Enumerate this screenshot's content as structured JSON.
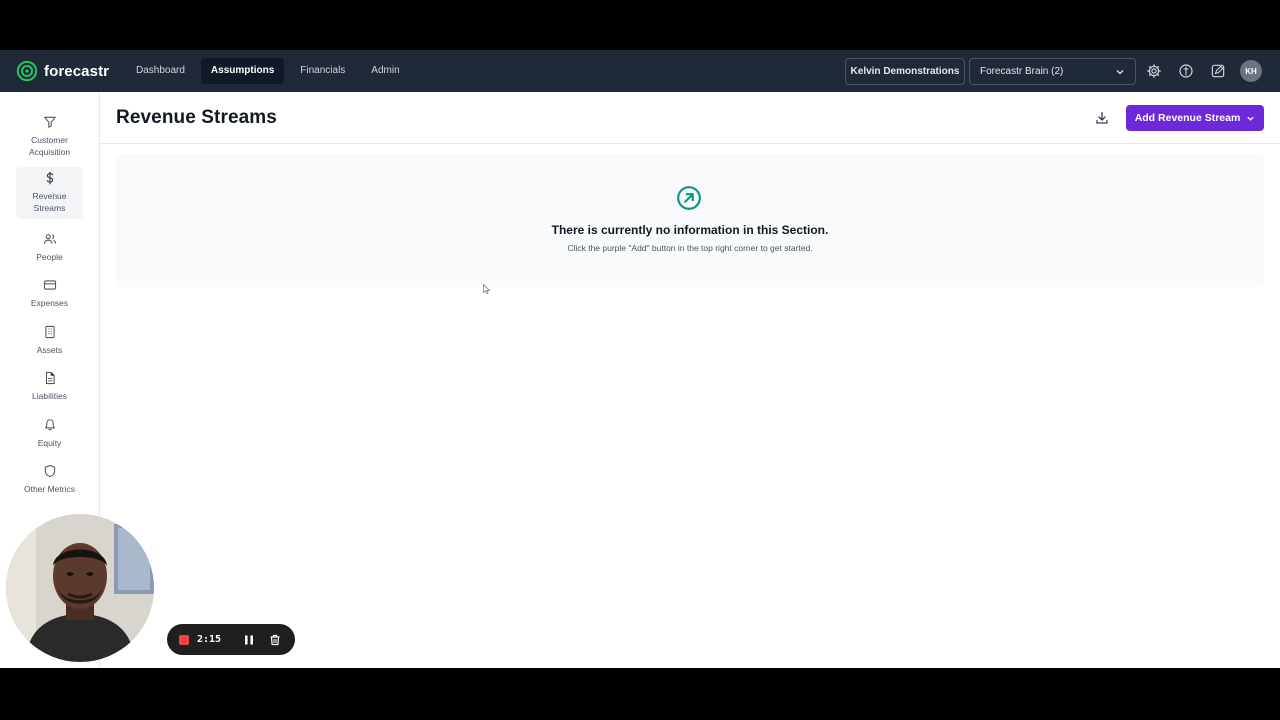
{
  "app": {
    "logo_text": "forecastr",
    "brand_color": "#22c55e",
    "accent_color": "#6d28d9"
  },
  "topnav": {
    "links": [
      {
        "label": "Dashboard",
        "active": false
      },
      {
        "label": "Assumptions",
        "active": true
      },
      {
        "label": "Financials",
        "active": false
      },
      {
        "label": "Admin",
        "active": false
      }
    ],
    "org_label": "Kelvin Demonstrations",
    "project_label": "Forecastr Brain (2)",
    "icons": [
      "gear-icon",
      "lightbulb-icon",
      "edit-icon"
    ],
    "avatar_initials": "KH"
  },
  "sidebar": {
    "items": [
      {
        "label": "Customer Acquisition",
        "icon": "funnel-icon",
        "active": false
      },
      {
        "label": "Revenue Streams",
        "icon": "dollar-icon",
        "active": true
      },
      {
        "label": "People",
        "icon": "people-icon",
        "active": false
      },
      {
        "label": "Expenses",
        "icon": "card-icon",
        "active": false
      },
      {
        "label": "Assets",
        "icon": "building-icon",
        "active": false
      },
      {
        "label": "Liabilities",
        "icon": "document-icon",
        "active": false
      },
      {
        "label": "Equity",
        "icon": "bell-icon",
        "active": false
      },
      {
        "label": "Other Metrics",
        "icon": "shield-icon",
        "active": false
      }
    ]
  },
  "main": {
    "title": "Revenue Streams",
    "add_button_label": "Add Revenue Stream",
    "empty_title": "There is currently no information in this Section.",
    "empty_subtitle": "Click the purple \"Add\" button in the top right corner to get started."
  },
  "recorder": {
    "time": "2:15"
  }
}
